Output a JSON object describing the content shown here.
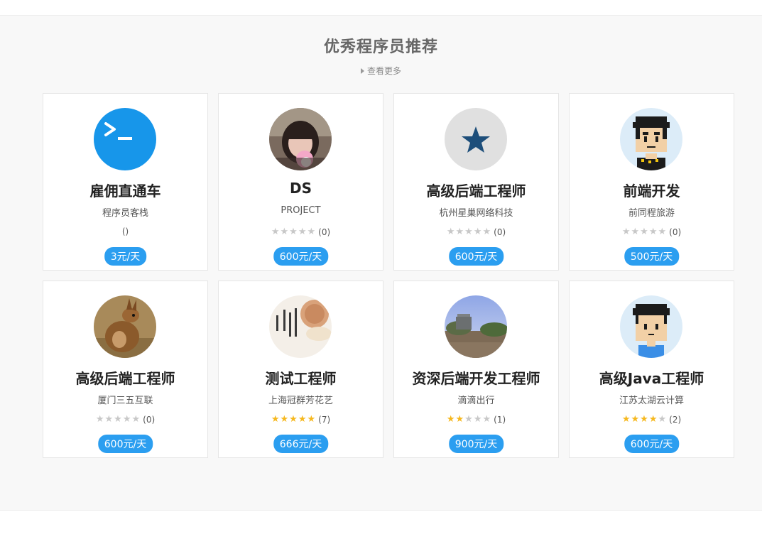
{
  "section": {
    "title": "优秀程序员推荐",
    "more_label": "查看更多"
  },
  "colors": {
    "accent": "#2b9ef0",
    "star_on": "#f6b81e",
    "star_off": "#c8c8c8"
  },
  "programmers": [
    {
      "name": "雇佣直通车",
      "company": "程序员客栈",
      "rating_text": "()",
      "stars": null,
      "count": "",
      "price": "3元/天",
      "avatar": "terminal-logo"
    },
    {
      "name": "DS",
      "company": "PROJECT",
      "rating_text": "",
      "stars": 0,
      "count": "(0)",
      "price": "600元/天",
      "avatar": "girl-photo"
    },
    {
      "name": "高级后端工程师",
      "company": "杭州星巢网络科技",
      "rating_text": "",
      "stars": 0,
      "count": "(0)",
      "price": "600元/天",
      "avatar": "star-logo"
    },
    {
      "name": "前端开发",
      "company": "前同程旅游",
      "rating_text": "",
      "stars": 0,
      "count": "(0)",
      "price": "500元/天",
      "avatar": "pixel-boy"
    },
    {
      "name": "高级后端工程师",
      "company": "厦门三五互联",
      "rating_text": "",
      "stars": 0,
      "count": "(0)",
      "price": "600元/天",
      "avatar": "kangaroo-photo"
    },
    {
      "name": "测试工程师",
      "company": "上海冠群芳花艺",
      "rating_text": "",
      "stars": 5,
      "count": "(7)",
      "price": "666元/天",
      "avatar": "calligraphy-photo"
    },
    {
      "name": "资深后端开发工程师",
      "company": "滴滴出行",
      "rating_text": "",
      "stars": 2,
      "count": "(1)",
      "price": "900元/天",
      "avatar": "landscape-photo"
    },
    {
      "name": "高级Java工程师",
      "company": "江苏太湖云计算",
      "rating_text": "",
      "stars": 4,
      "count": "(2)",
      "price": "600元/天",
      "avatar": "pixel-boy-blue"
    }
  ]
}
